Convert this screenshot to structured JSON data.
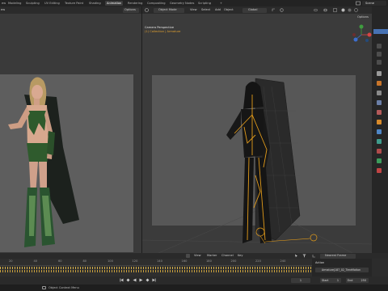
{
  "topbar": {
    "tabs": [
      "Modeling",
      "Sculpting",
      "UV Editing",
      "Texture Paint",
      "Shading",
      "Animation",
      "Rendering",
      "Compositing",
      "Geometry Nodes",
      "Scripting",
      "+"
    ],
    "active_tab": "Animation",
    "scene": "Scene"
  },
  "left_header": {
    "options": "Options",
    "menu_suffix": "ew"
  },
  "right_header": {
    "mode": "Object Mode",
    "menus": [
      "View",
      "Select",
      "Add",
      "Object"
    ],
    "orientation": "Global",
    "options": "Options"
  },
  "viewport": {
    "camera_label": "Camera Perspective",
    "collection_label": "(1) Collection | Armature"
  },
  "timeline": {
    "menus": [
      "View",
      "Marker",
      "Channel",
      "Key"
    ],
    "ticks": [
      "20",
      "40",
      "60",
      "80",
      "100",
      "120",
      "140",
      "160",
      "180",
      "200",
      "220",
      "240"
    ],
    "interpolation": "Nearest Frame",
    "current_frame": "1",
    "start_label": "Start",
    "start": "1",
    "end_label": "End",
    "end": "250"
  },
  "action_panel": {
    "title": "Action",
    "action_name": "Armature|187_02_TimeMotion"
  },
  "statusbar": {
    "hint": "Object Context Menu"
  },
  "colors": {
    "accent": "#e29b1a",
    "active_tab": "#3d3d3d",
    "selection": "#4772b3",
    "keyframe": "#d8b24a"
  }
}
